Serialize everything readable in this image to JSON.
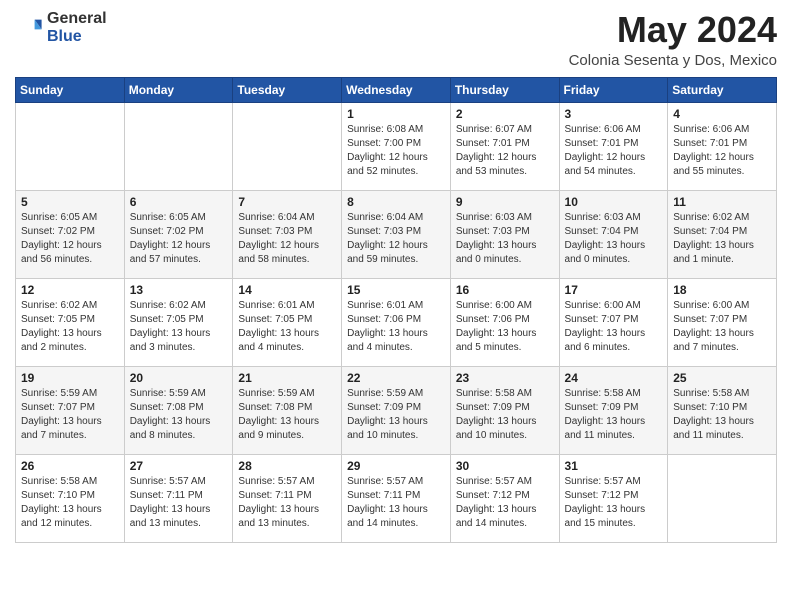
{
  "logo": {
    "general": "General",
    "blue": "Blue"
  },
  "header": {
    "month_year": "May 2024",
    "location": "Colonia Sesenta y Dos, Mexico"
  },
  "weekdays": [
    "Sunday",
    "Monday",
    "Tuesday",
    "Wednesday",
    "Thursday",
    "Friday",
    "Saturday"
  ],
  "weeks": [
    [
      {
        "num": "",
        "sunrise": "",
        "sunset": "",
        "daylight": ""
      },
      {
        "num": "",
        "sunrise": "",
        "sunset": "",
        "daylight": ""
      },
      {
        "num": "",
        "sunrise": "",
        "sunset": "",
        "daylight": ""
      },
      {
        "num": "1",
        "sunrise": "Sunrise: 6:08 AM",
        "sunset": "Sunset: 7:00 PM",
        "daylight": "Daylight: 12 hours and 52 minutes."
      },
      {
        "num": "2",
        "sunrise": "Sunrise: 6:07 AM",
        "sunset": "Sunset: 7:01 PM",
        "daylight": "Daylight: 12 hours and 53 minutes."
      },
      {
        "num": "3",
        "sunrise": "Sunrise: 6:06 AM",
        "sunset": "Sunset: 7:01 PM",
        "daylight": "Daylight: 12 hours and 54 minutes."
      },
      {
        "num": "4",
        "sunrise": "Sunrise: 6:06 AM",
        "sunset": "Sunset: 7:01 PM",
        "daylight": "Daylight: 12 hours and 55 minutes."
      }
    ],
    [
      {
        "num": "5",
        "sunrise": "Sunrise: 6:05 AM",
        "sunset": "Sunset: 7:02 PM",
        "daylight": "Daylight: 12 hours and 56 minutes."
      },
      {
        "num": "6",
        "sunrise": "Sunrise: 6:05 AM",
        "sunset": "Sunset: 7:02 PM",
        "daylight": "Daylight: 12 hours and 57 minutes."
      },
      {
        "num": "7",
        "sunrise": "Sunrise: 6:04 AM",
        "sunset": "Sunset: 7:03 PM",
        "daylight": "Daylight: 12 hours and 58 minutes."
      },
      {
        "num": "8",
        "sunrise": "Sunrise: 6:04 AM",
        "sunset": "Sunset: 7:03 PM",
        "daylight": "Daylight: 12 hours and 59 minutes."
      },
      {
        "num": "9",
        "sunrise": "Sunrise: 6:03 AM",
        "sunset": "Sunset: 7:03 PM",
        "daylight": "Daylight: 13 hours and 0 minutes."
      },
      {
        "num": "10",
        "sunrise": "Sunrise: 6:03 AM",
        "sunset": "Sunset: 7:04 PM",
        "daylight": "Daylight: 13 hours and 0 minutes."
      },
      {
        "num": "11",
        "sunrise": "Sunrise: 6:02 AM",
        "sunset": "Sunset: 7:04 PM",
        "daylight": "Daylight: 13 hours and 1 minute."
      }
    ],
    [
      {
        "num": "12",
        "sunrise": "Sunrise: 6:02 AM",
        "sunset": "Sunset: 7:05 PM",
        "daylight": "Daylight: 13 hours and 2 minutes."
      },
      {
        "num": "13",
        "sunrise": "Sunrise: 6:02 AM",
        "sunset": "Sunset: 7:05 PM",
        "daylight": "Daylight: 13 hours and 3 minutes."
      },
      {
        "num": "14",
        "sunrise": "Sunrise: 6:01 AM",
        "sunset": "Sunset: 7:05 PM",
        "daylight": "Daylight: 13 hours and 4 minutes."
      },
      {
        "num": "15",
        "sunrise": "Sunrise: 6:01 AM",
        "sunset": "Sunset: 7:06 PM",
        "daylight": "Daylight: 13 hours and 4 minutes."
      },
      {
        "num": "16",
        "sunrise": "Sunrise: 6:00 AM",
        "sunset": "Sunset: 7:06 PM",
        "daylight": "Daylight: 13 hours and 5 minutes."
      },
      {
        "num": "17",
        "sunrise": "Sunrise: 6:00 AM",
        "sunset": "Sunset: 7:07 PM",
        "daylight": "Daylight: 13 hours and 6 minutes."
      },
      {
        "num": "18",
        "sunrise": "Sunrise: 6:00 AM",
        "sunset": "Sunset: 7:07 PM",
        "daylight": "Daylight: 13 hours and 7 minutes."
      }
    ],
    [
      {
        "num": "19",
        "sunrise": "Sunrise: 5:59 AM",
        "sunset": "Sunset: 7:07 PM",
        "daylight": "Daylight: 13 hours and 7 minutes."
      },
      {
        "num": "20",
        "sunrise": "Sunrise: 5:59 AM",
        "sunset": "Sunset: 7:08 PM",
        "daylight": "Daylight: 13 hours and 8 minutes."
      },
      {
        "num": "21",
        "sunrise": "Sunrise: 5:59 AM",
        "sunset": "Sunset: 7:08 PM",
        "daylight": "Daylight: 13 hours and 9 minutes."
      },
      {
        "num": "22",
        "sunrise": "Sunrise: 5:59 AM",
        "sunset": "Sunset: 7:09 PM",
        "daylight": "Daylight: 13 hours and 10 minutes."
      },
      {
        "num": "23",
        "sunrise": "Sunrise: 5:58 AM",
        "sunset": "Sunset: 7:09 PM",
        "daylight": "Daylight: 13 hours and 10 minutes."
      },
      {
        "num": "24",
        "sunrise": "Sunrise: 5:58 AM",
        "sunset": "Sunset: 7:09 PM",
        "daylight": "Daylight: 13 hours and 11 minutes."
      },
      {
        "num": "25",
        "sunrise": "Sunrise: 5:58 AM",
        "sunset": "Sunset: 7:10 PM",
        "daylight": "Daylight: 13 hours and 11 minutes."
      }
    ],
    [
      {
        "num": "26",
        "sunrise": "Sunrise: 5:58 AM",
        "sunset": "Sunset: 7:10 PM",
        "daylight": "Daylight: 13 hours and 12 minutes."
      },
      {
        "num": "27",
        "sunrise": "Sunrise: 5:57 AM",
        "sunset": "Sunset: 7:11 PM",
        "daylight": "Daylight: 13 hours and 13 minutes."
      },
      {
        "num": "28",
        "sunrise": "Sunrise: 5:57 AM",
        "sunset": "Sunset: 7:11 PM",
        "daylight": "Daylight: 13 hours and 13 minutes."
      },
      {
        "num": "29",
        "sunrise": "Sunrise: 5:57 AM",
        "sunset": "Sunset: 7:11 PM",
        "daylight": "Daylight: 13 hours and 14 minutes."
      },
      {
        "num": "30",
        "sunrise": "Sunrise: 5:57 AM",
        "sunset": "Sunset: 7:12 PM",
        "daylight": "Daylight: 13 hours and 14 minutes."
      },
      {
        "num": "31",
        "sunrise": "Sunrise: 5:57 AM",
        "sunset": "Sunset: 7:12 PM",
        "daylight": "Daylight: 13 hours and 15 minutes."
      },
      {
        "num": "",
        "sunrise": "",
        "sunset": "",
        "daylight": ""
      }
    ]
  ]
}
